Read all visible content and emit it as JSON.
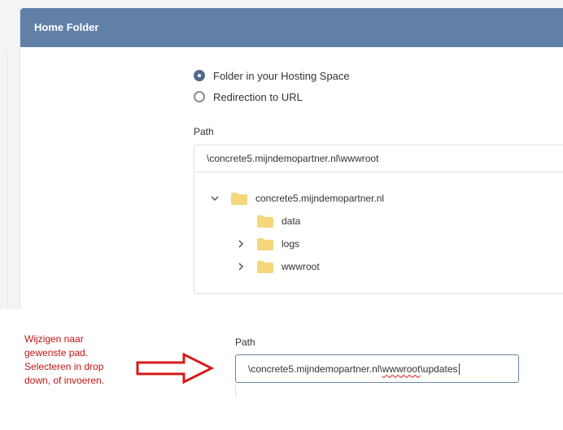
{
  "panel": {
    "title": "Home Folder"
  },
  "radio_options": [
    {
      "label": "Folder in your Hosting Space",
      "selected": true
    },
    {
      "label": "Redirection to URL",
      "selected": false
    }
  ],
  "path_section": {
    "label": "Path",
    "value": "\\concrete5.mijndemopartner.nl\\wwwroot"
  },
  "tree": {
    "root": {
      "label": "concrete5.mijndemopartner.nl",
      "expanded": true
    },
    "children": [
      {
        "label": "data",
        "has_children": false
      },
      {
        "label": "logs",
        "has_children": true
      },
      {
        "label": "wwwroot",
        "has_children": true
      }
    ]
  },
  "annotation": {
    "lines": [
      "Wijzigen naar",
      "gewenste pad.",
      "Selecteren in drop",
      "down, of invoeren."
    ]
  },
  "edited_path": {
    "label": "Path",
    "value_prefix": "\\concrete5.mijndemopartner.nl\\",
    "value_misspelled": "wwwroot",
    "value_suffix": "\\updates"
  },
  "colors": {
    "header": "#6180a8",
    "radio_selected": "#53698a",
    "folder": "#f5d67a",
    "annotation_red": "#c01313"
  }
}
